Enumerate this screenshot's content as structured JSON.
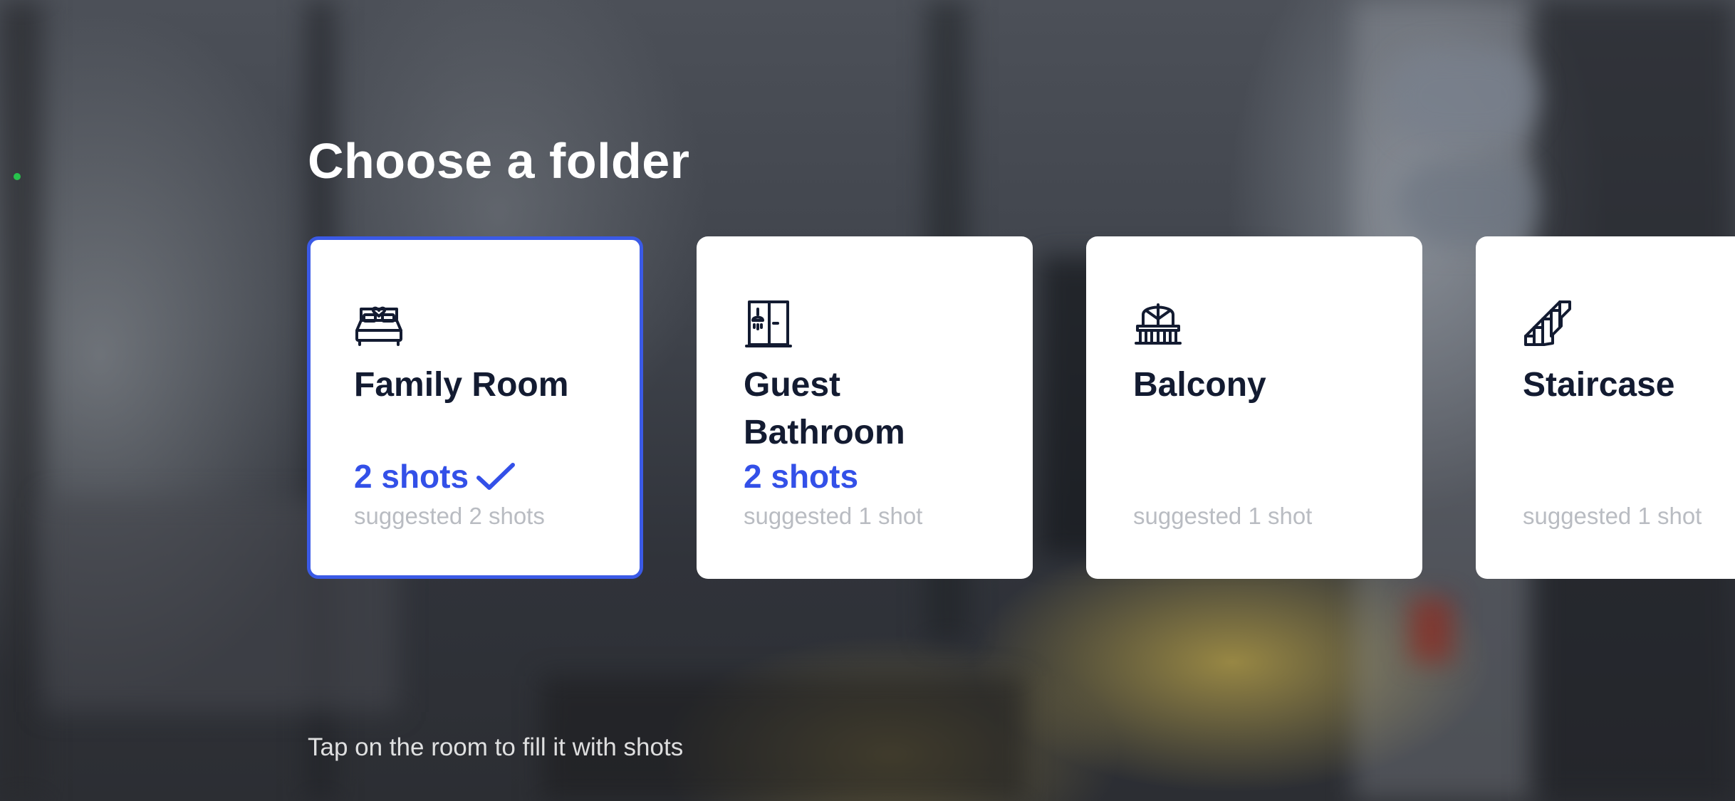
{
  "screen": {
    "title": "Choose a folder",
    "hint": "Tap on the room to fill it with shots"
  },
  "colors": {
    "accent": "#3b5ae6",
    "card_text": "#131b31",
    "muted_text": "#b9bcc2",
    "status_dot": "#27c24c"
  },
  "folders": [
    {
      "name": "Family Room",
      "shots": "2 shots",
      "suggested": "suggested 2 shots",
      "icon": "bed-icon",
      "selected": true
    },
    {
      "name": "Guest Bathroom",
      "shots": "2 shots",
      "suggested": "suggested 1 shot",
      "icon": "shower-icon",
      "selected": false
    },
    {
      "name": "Balcony",
      "shots": "",
      "suggested": "suggested 1 shot",
      "icon": "balcony-icon",
      "selected": false
    },
    {
      "name": "Staircase",
      "shots": "",
      "suggested": "suggested 1 shot",
      "icon": "stairs-icon",
      "selected": false
    }
  ]
}
